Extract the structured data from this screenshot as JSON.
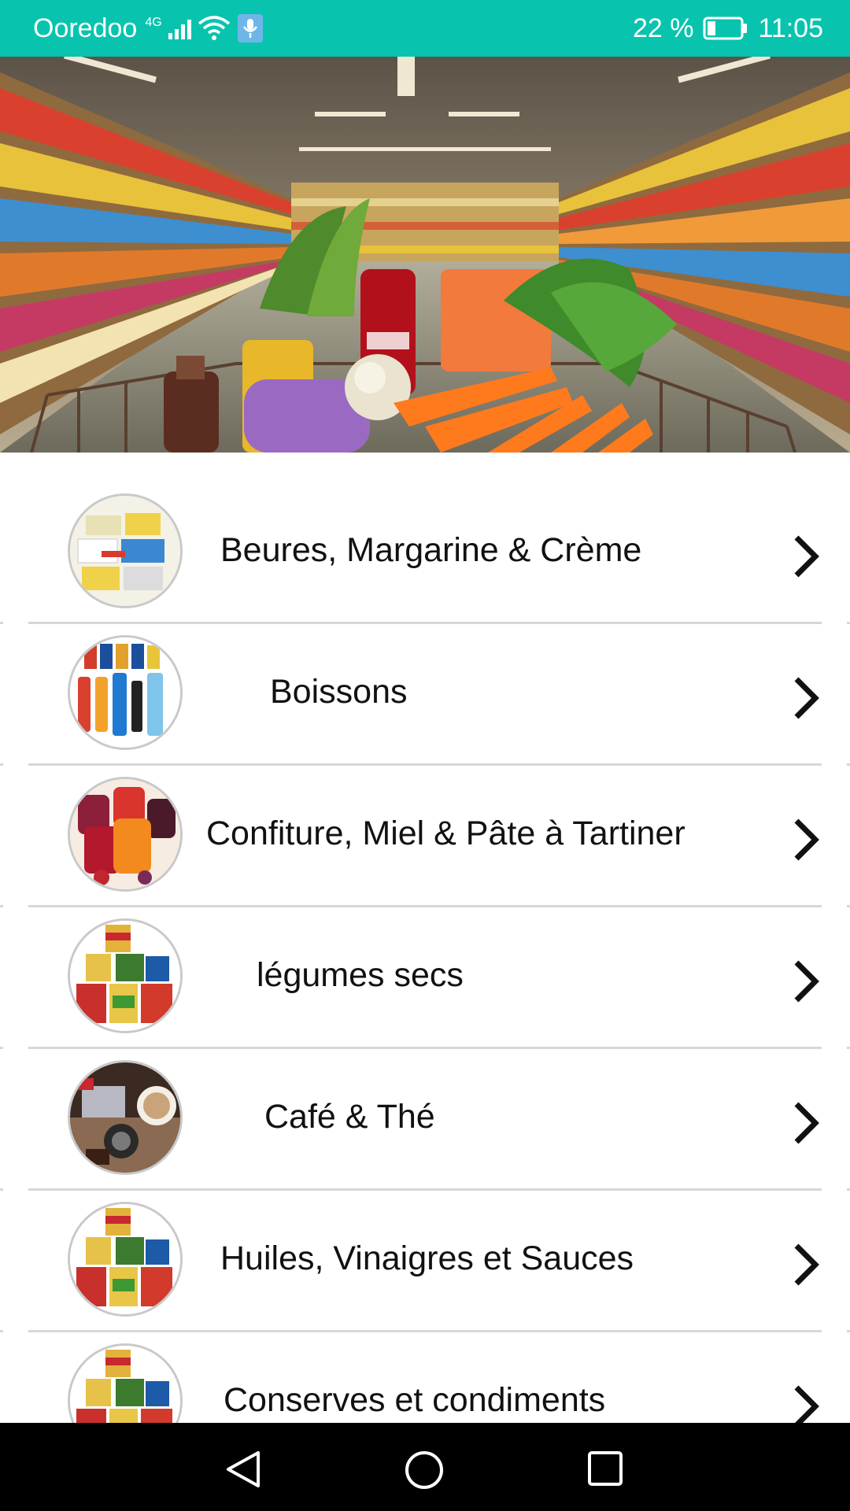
{
  "status_bar": {
    "carrier": "Ooredoo",
    "network_tag": "4G",
    "battery": "22 %",
    "time": "11:05"
  },
  "banner": {
    "image_name": "supermarket-cart-banner"
  },
  "categories": [
    {
      "label": "Beures, Margarine & Crème"
    },
    {
      "label": "Boissons"
    },
    {
      "label": "Confiture, Miel & Pâte à Tartiner"
    },
    {
      "label": "légumes secs"
    },
    {
      "label": "Café & Thé"
    },
    {
      "label": "Huiles, Vinaigres et Sauces"
    },
    {
      "label": "Conserves et condiments"
    }
  ],
  "colors": {
    "status_bar": "#08c4ae",
    "nav_bar": "#000000",
    "divider": "#d7d7d7"
  },
  "nav": {
    "back_icon": "back-triangle-icon",
    "home_icon": "home-circle-icon",
    "recents_icon": "recents-square-icon"
  }
}
